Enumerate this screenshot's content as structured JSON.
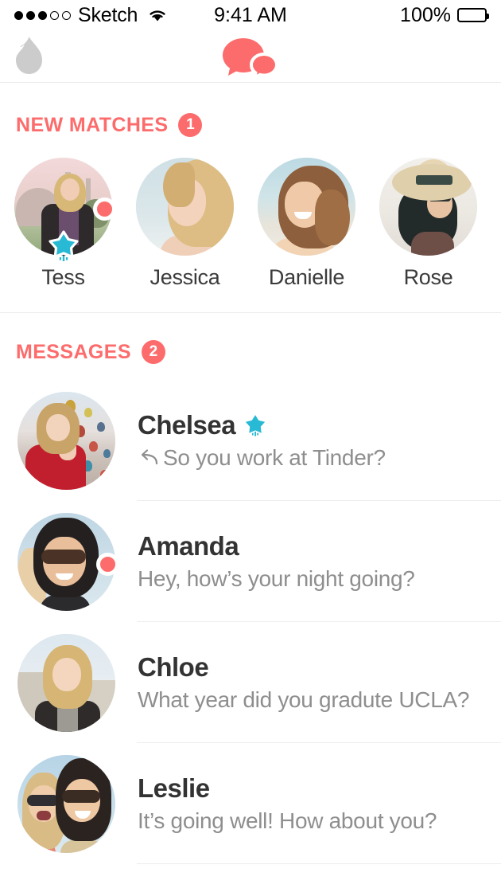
{
  "status_bar": {
    "carrier": "Sketch",
    "signal_filled": 3,
    "signal_total": 5,
    "wifi_icon": "wifi-icon",
    "time": "9:41 AM",
    "battery_percent": "100%",
    "battery_level": 100
  },
  "nav_bar": {
    "left_icon": "tinder-flame-icon",
    "center_icon": "chat-bubbles-icon",
    "flame_color": "#CCCCCC",
    "chat_color": "#FD6C6C"
  },
  "theme": {
    "accent": "#FD6C6C",
    "super_like_blue": "#28B9D4",
    "name_color": "#333333",
    "preview_color": "#8E8E8E",
    "divider": "#EDEDED"
  },
  "new_matches": {
    "title": "NEW MATCHES",
    "badge": "1",
    "items": [
      {
        "name": "Tess",
        "has_new_dot": true,
        "has_super_like": true
      },
      {
        "name": "Jessica",
        "has_new_dot": false,
        "has_super_like": false
      },
      {
        "name": "Danielle",
        "has_new_dot": false,
        "has_super_like": false
      },
      {
        "name": "Rose",
        "has_new_dot": false,
        "has_super_like": false
      }
    ]
  },
  "messages": {
    "title": "MESSAGES",
    "badge": "2",
    "items": [
      {
        "name": "Chelsea",
        "preview": "So you work at Tinder?",
        "has_super_like": true,
        "has_unread_dot": false,
        "is_reply": true,
        "reply_arrow": "↩"
      },
      {
        "name": "Amanda",
        "preview": "Hey, how’s your night going?",
        "has_super_like": false,
        "has_unread_dot": true,
        "is_reply": false,
        "reply_arrow": ""
      },
      {
        "name": "Chloe",
        "preview": "What year did you gradute UCLA?",
        "has_super_like": false,
        "has_unread_dot": false,
        "is_reply": false,
        "reply_arrow": ""
      },
      {
        "name": "Leslie",
        "preview": "It’s going well! How about you?",
        "has_super_like": false,
        "has_unread_dot": false,
        "is_reply": false,
        "reply_arrow": ""
      }
    ]
  }
}
